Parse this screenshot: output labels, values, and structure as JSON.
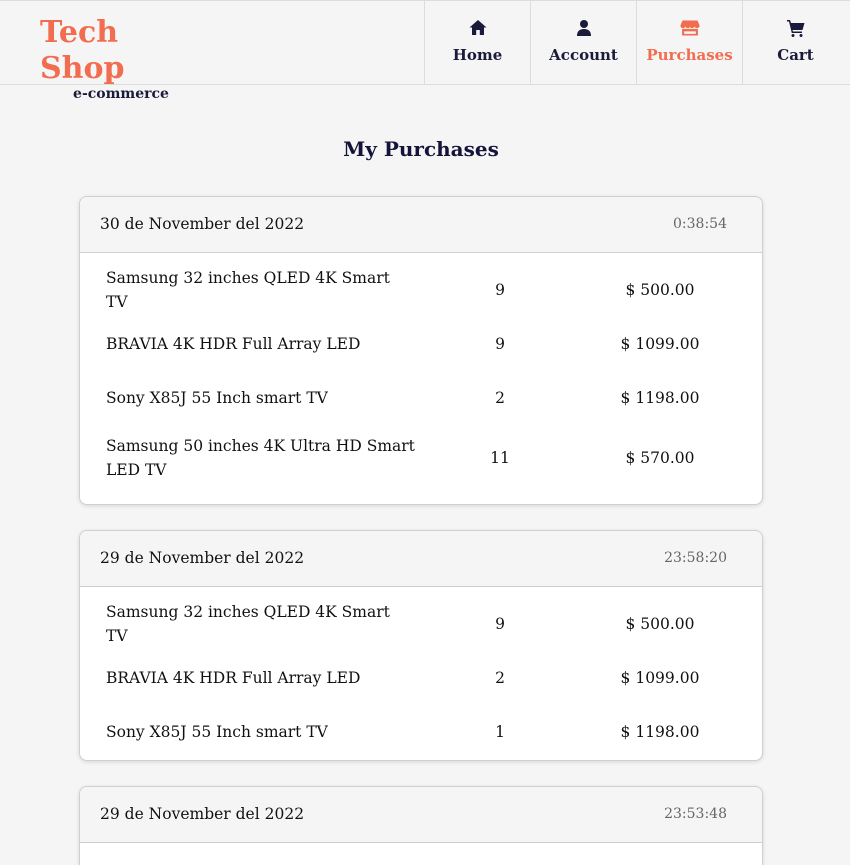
{
  "brand": {
    "title": "Tech Shop",
    "subtitle": "e-commerce"
  },
  "nav": [
    {
      "label": "Home",
      "icon": "home-icon"
    },
    {
      "label": "Account",
      "icon": "user-icon"
    },
    {
      "label": "Purchases",
      "icon": "store-icon",
      "active": true
    },
    {
      "label": "Cart",
      "icon": "cart-icon"
    }
  ],
  "colors": {
    "accent": "#f26d4f",
    "dark": "#1a1a3a",
    "background": "#f5f5f5"
  },
  "page_title": "My Purchases",
  "purchases": [
    {
      "date": "30 de November del 2022",
      "time": "0:38:54",
      "items": [
        {
          "name": "Samsung 32 inches QLED 4K Smart TV",
          "qty": "9",
          "price": "$ 500.00"
        },
        {
          "name": "BRAVIA 4K HDR Full Array LED",
          "qty": "9",
          "price": "$ 1099.00"
        },
        {
          "name": "Sony X85J 55 Inch smart TV",
          "qty": "2",
          "price": "$ 1198.00"
        },
        {
          "name": "Samsung 50 inches 4K Ultra HD Smart LED TV",
          "qty": "11",
          "price": "$ 570.00"
        }
      ]
    },
    {
      "date": "29 de November del 2022",
      "time": "23:58:20",
      "items": [
        {
          "name": "Samsung 32 inches QLED 4K Smart TV",
          "qty": "9",
          "price": "$ 500.00"
        },
        {
          "name": "BRAVIA 4K HDR Full Array LED",
          "qty": "2",
          "price": "$ 1099.00"
        },
        {
          "name": "Sony X85J 55 Inch smart TV",
          "qty": "1",
          "price": "$ 1198.00"
        }
      ]
    },
    {
      "date": "29 de November del 2022",
      "time": "23:53:48",
      "items": []
    }
  ]
}
